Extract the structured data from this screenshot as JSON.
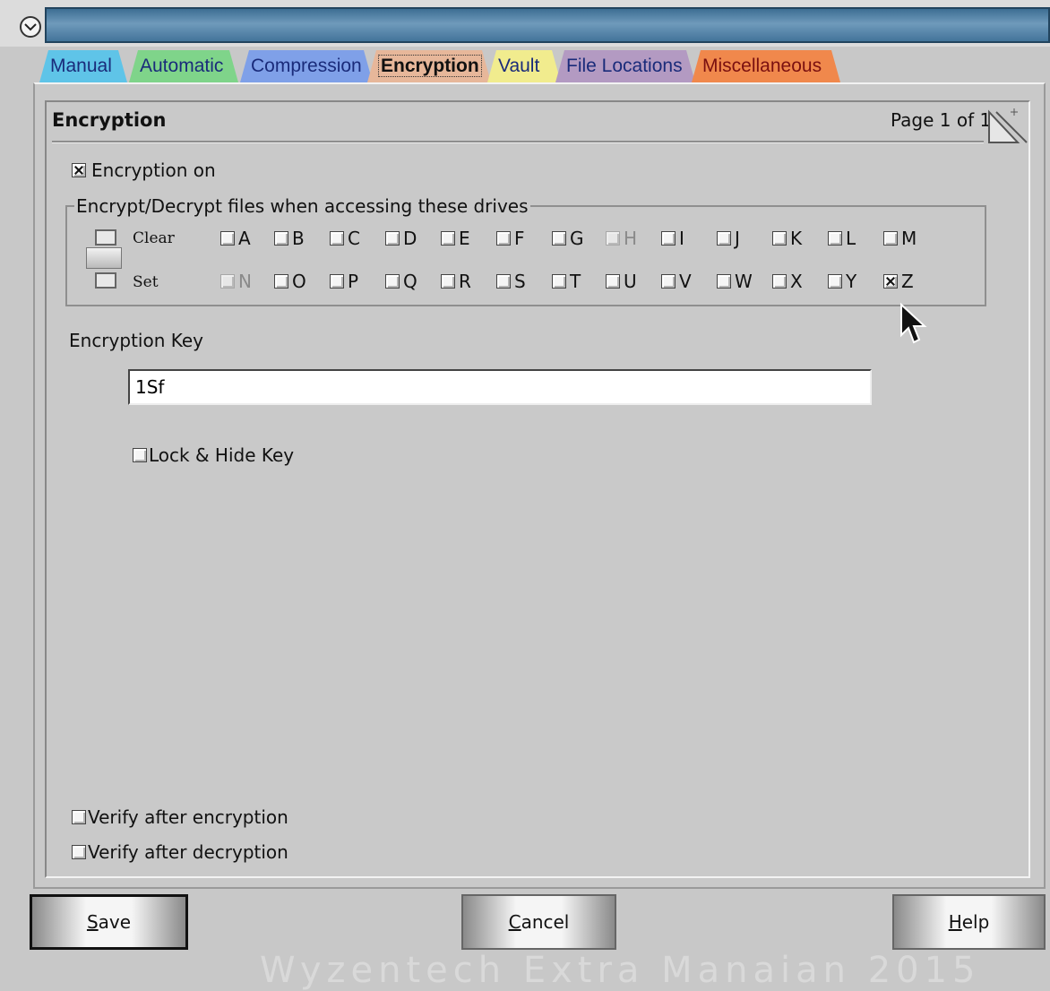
{
  "tabs": [
    {
      "label": "Manual",
      "color": "#5fc4e8",
      "active": false
    },
    {
      "label": "Automatic",
      "color": "#7fd48a",
      "active": false
    },
    {
      "label": "Compression",
      "color": "#7fa0e8",
      "active": false
    },
    {
      "label": "Encryption",
      "color": "#e7b79a",
      "active": true
    },
    {
      "label": "Vault",
      "color": "#f1ec8e",
      "active": false
    },
    {
      "label": "File Locations",
      "color": "#b39ac2",
      "active": false
    },
    {
      "label": "Miscellaneous",
      "color": "#f0884c",
      "active": false
    }
  ],
  "section": {
    "title": "Encryption",
    "page_info": "Page 1 of 1"
  },
  "encryption_on": {
    "label": "Encryption on",
    "checked": true
  },
  "drives": {
    "legend": "Encrypt/Decrypt files when accessing these drives",
    "clear_label": "Clear",
    "set_label": "Set",
    "row1": [
      {
        "letter": "A",
        "checked": false,
        "disabled": false
      },
      {
        "letter": "B",
        "checked": false,
        "disabled": false
      },
      {
        "letter": "C",
        "checked": false,
        "disabled": false
      },
      {
        "letter": "D",
        "checked": false,
        "disabled": false
      },
      {
        "letter": "E",
        "checked": false,
        "disabled": false
      },
      {
        "letter": "F",
        "checked": false,
        "disabled": false
      },
      {
        "letter": "G",
        "checked": false,
        "disabled": false
      },
      {
        "letter": "H",
        "checked": false,
        "disabled": true
      },
      {
        "letter": "I",
        "checked": false,
        "disabled": false
      },
      {
        "letter": "J",
        "checked": false,
        "disabled": false
      },
      {
        "letter": "K",
        "checked": false,
        "disabled": false
      },
      {
        "letter": "L",
        "checked": false,
        "disabled": false
      },
      {
        "letter": "M",
        "checked": false,
        "disabled": false
      }
    ],
    "row2": [
      {
        "letter": "N",
        "checked": false,
        "disabled": true
      },
      {
        "letter": "O",
        "checked": false,
        "disabled": false
      },
      {
        "letter": "P",
        "checked": false,
        "disabled": false
      },
      {
        "letter": "Q",
        "checked": false,
        "disabled": false
      },
      {
        "letter": "R",
        "checked": false,
        "disabled": false
      },
      {
        "letter": "S",
        "checked": false,
        "disabled": false
      },
      {
        "letter": "T",
        "checked": false,
        "disabled": false
      },
      {
        "letter": "U",
        "checked": false,
        "disabled": false
      },
      {
        "letter": "V",
        "checked": false,
        "disabled": false
      },
      {
        "letter": "W",
        "checked": false,
        "disabled": false
      },
      {
        "letter": "X",
        "checked": false,
        "disabled": false
      },
      {
        "letter": "Y",
        "checked": false,
        "disabled": false
      },
      {
        "letter": "Z",
        "checked": true,
        "disabled": false
      }
    ]
  },
  "key": {
    "label": "Encryption Key",
    "value": "1Sf"
  },
  "lock_hide": {
    "label": "Lock & Hide Key",
    "checked": false
  },
  "verify_enc": {
    "label": "Verify after encryption",
    "checked": false
  },
  "verify_dec": {
    "label": "Verify after decryption",
    "checked": false
  },
  "buttons": {
    "save": {
      "mnemonic": "S",
      "rest": "ave"
    },
    "cancel": {
      "mnemonic": "C",
      "rest": "ancel"
    },
    "help": {
      "mnemonic": "H",
      "rest": "elp"
    }
  },
  "footer": "Wyzentech Extra Manaian 2015"
}
